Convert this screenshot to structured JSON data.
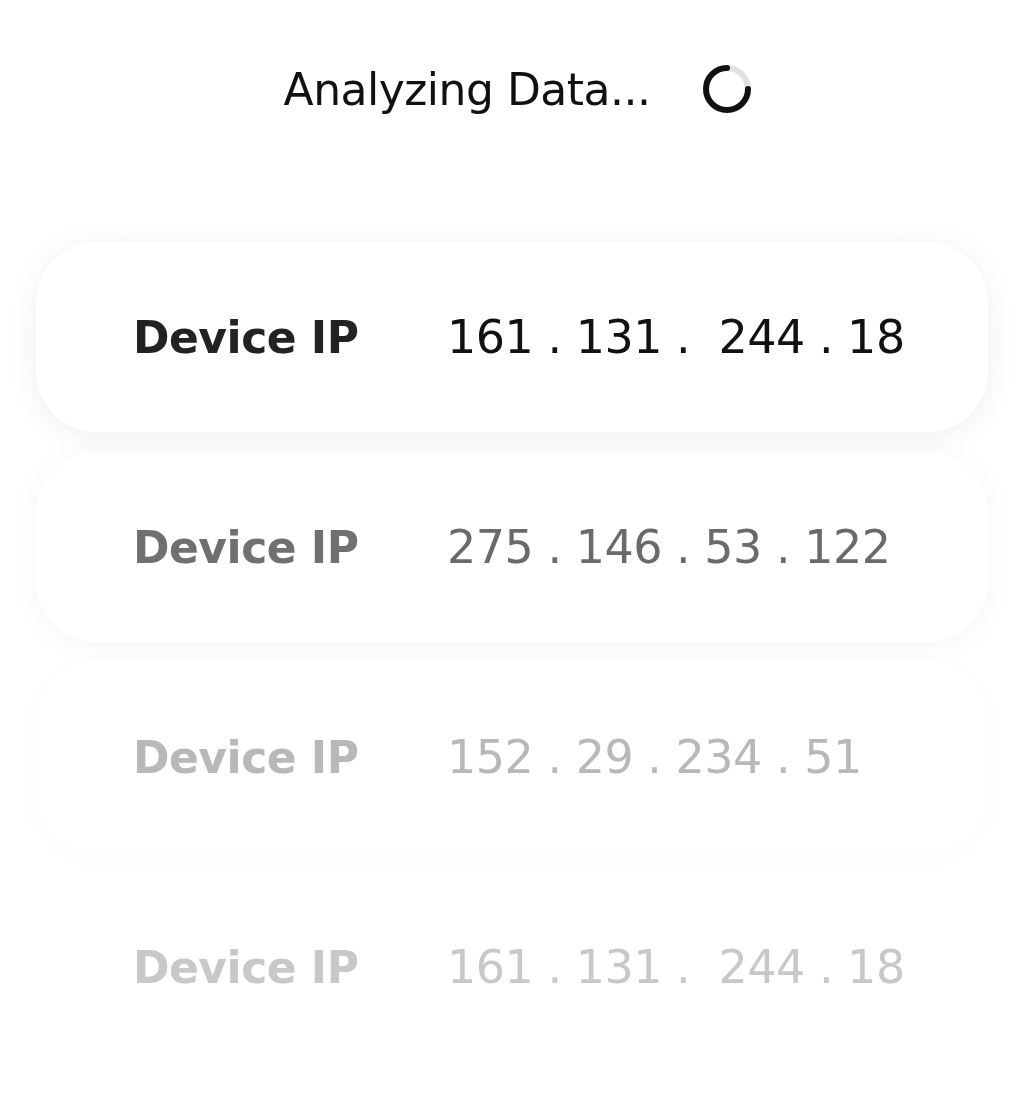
{
  "header": {
    "title": "Analyzing Data..."
  },
  "devices": [
    {
      "label": "Device IP",
      "ip": "161 . 131 .  244 . 18",
      "kind": "active"
    },
    {
      "label": "Device IP",
      "ip": "275 . 146 . 53 . 122",
      "kind": "muted"
    },
    {
      "label": "Device IP",
      "ip": "152 . 29 . 234 . 51",
      "kind": "faint"
    },
    {
      "label": "Device IP",
      "ip": "161 . 131 .  244 . 18",
      "kind": "ghost"
    }
  ]
}
